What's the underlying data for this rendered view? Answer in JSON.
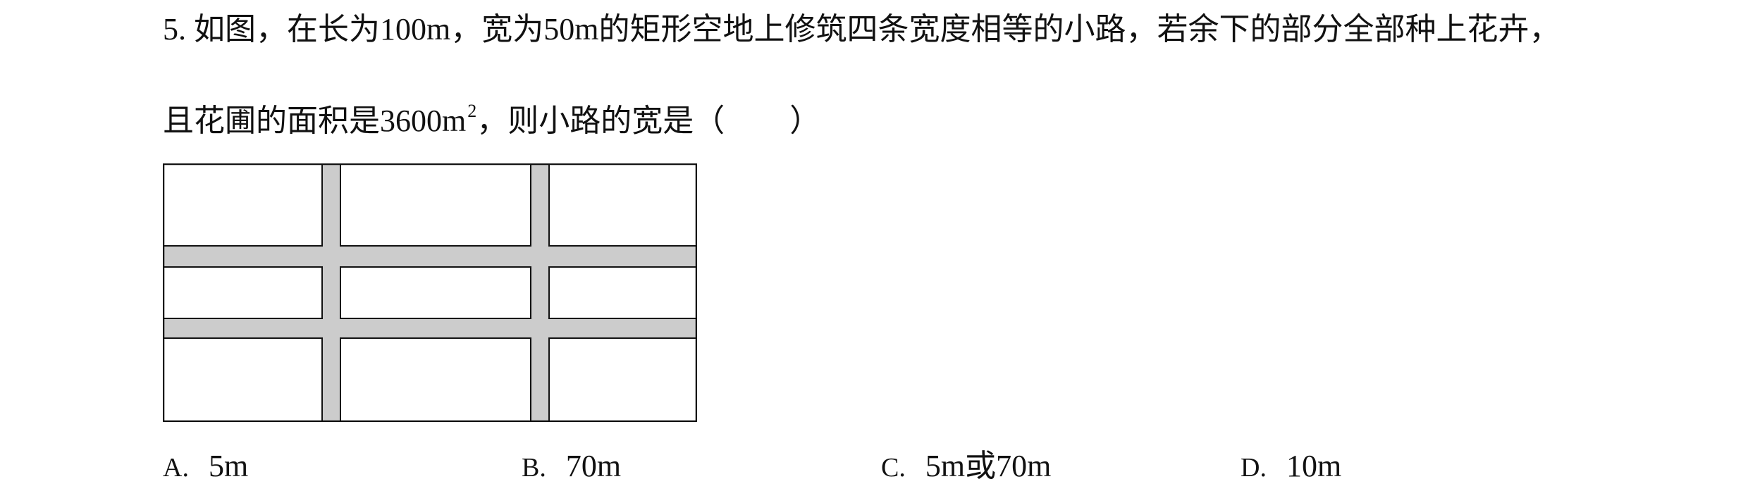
{
  "question": {
    "number": "5.",
    "line1": "如图，在长为100m，宽为50m的矩形空地上修筑四条宽度相等的小路，若余下的部分全部种上花卉，",
    "line2_before": "且花圃的面积是3600m",
    "line2_superscript": "2",
    "line2_after": "，则小路的宽是（",
    "line2_close": "）"
  },
  "figure": {
    "road_color": "#cccccc",
    "plot_color": "#ffffff",
    "border_color": "#111111"
  },
  "choices": [
    {
      "letter": "A.",
      "text": "5m"
    },
    {
      "letter": "B.",
      "text": "70m"
    },
    {
      "letter": "C.",
      "text": "5m或70m"
    },
    {
      "letter": "D.",
      "text": "10m"
    }
  ]
}
